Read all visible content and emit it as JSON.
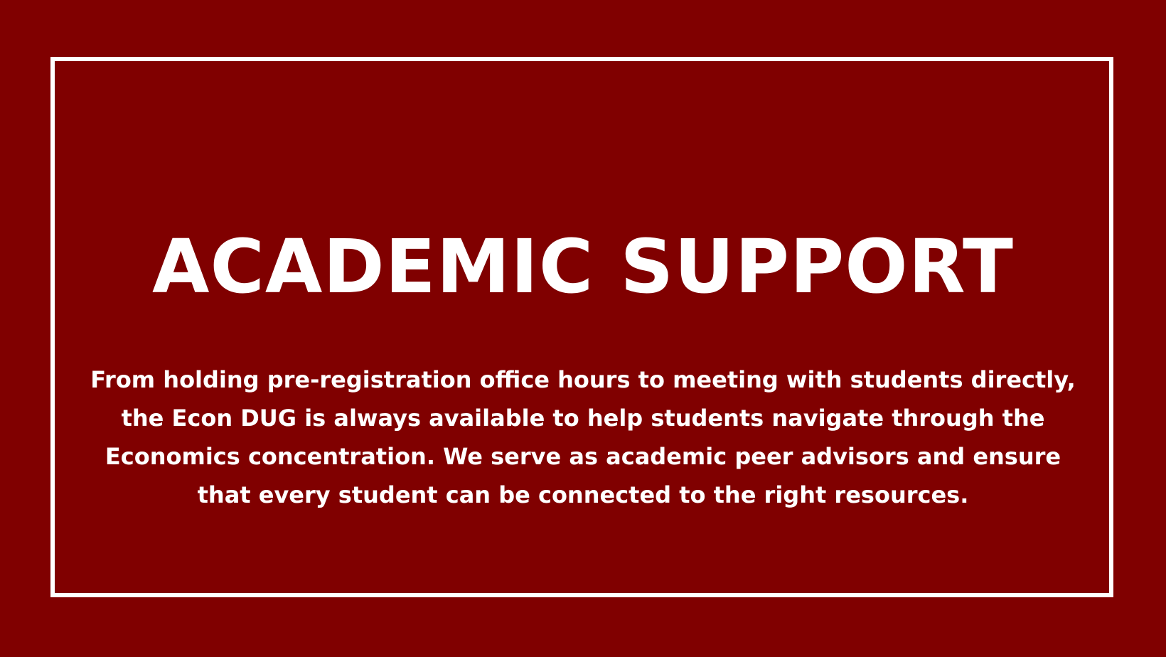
{
  "colors": {
    "background": "#800000",
    "frame": "#ffffff",
    "text": "#ffffff"
  },
  "title": "ACADEMIC SUPPORT",
  "body_lines": [
    "From holding pre-registration office hours to meeting with students directly,",
    "the Econ DUG is always available to help students navigate through the",
    "Economics concentration. We serve as academic peer advisors and ensure",
    "that every student can be connected to the right resources."
  ]
}
